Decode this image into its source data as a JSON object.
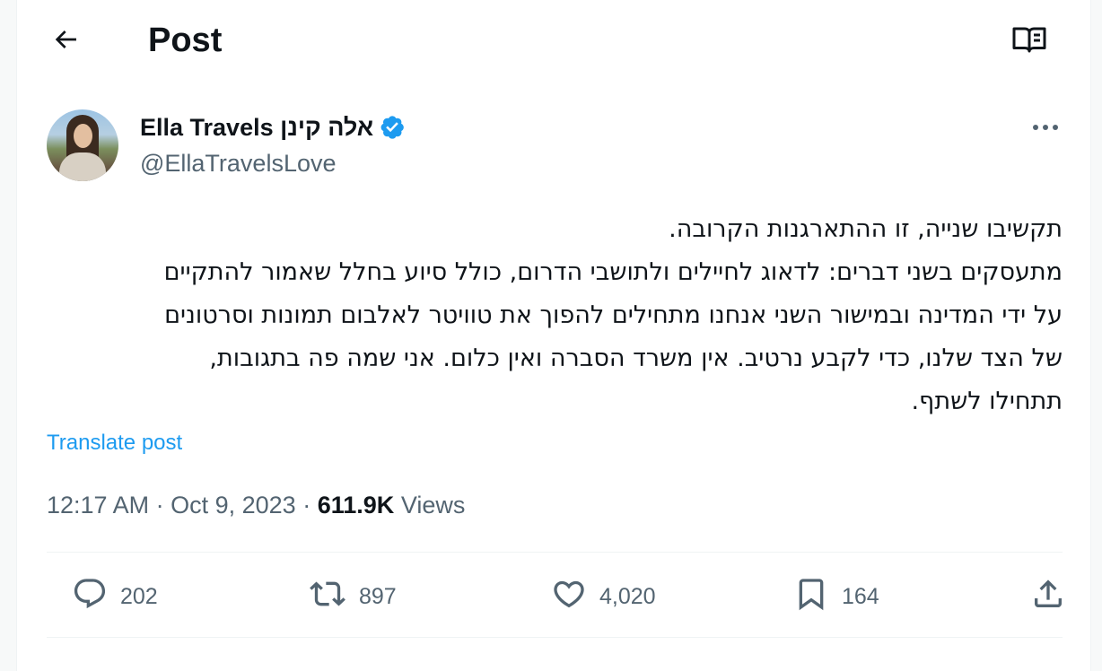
{
  "header": {
    "title": "Post",
    "back_icon": "arrow-left-icon",
    "reader_icon": "book-open-icon"
  },
  "author": {
    "display_name": "Ella Travels אלה קינן",
    "handle": "@EllaTravelsLove",
    "verified_color": "#1d9bf0"
  },
  "post": {
    "lines": [
      "תקשיבו שנייה, זו ההתארגנות הקרובה.",
      "מתעסקים בשני דברים: לדאוג לחיילים ולתושבי הדרום, כולל סיוע בחלל שאמור להתקיים",
      "על ידי המדינה ובמישור השני אנחנו מתחילים להפוך את טוויטר לאלבום תמונות וסרטונים",
      "של הצד שלנו, כדי לקבע נרטיב. אין משרד הסברה ואין כלום. אני שמה פה בתגובות,",
      "תתחילו לשתף."
    ],
    "translate_label": "Translate post"
  },
  "meta": {
    "time": "12:17 AM",
    "separator": "·",
    "date": "Oct 9, 2023",
    "views_count": "611.9K",
    "views_label": "Views"
  },
  "actions": {
    "replies": "202",
    "reposts": "897",
    "likes": "4,020",
    "bookmarks": "164"
  },
  "colors": {
    "accent": "#1d9bf0",
    "secondary_text": "#536471",
    "primary_text": "#0f1419"
  }
}
